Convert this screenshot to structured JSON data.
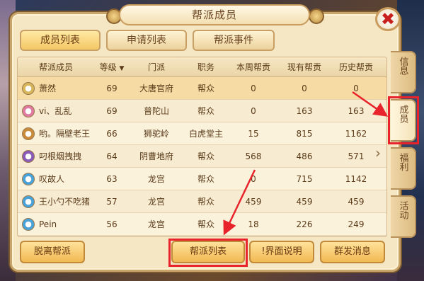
{
  "title": "帮派成员",
  "tabs": [
    {
      "label": "成员列表",
      "active": true
    },
    {
      "label": "申请列表",
      "active": false
    },
    {
      "label": "帮派事件",
      "active": false
    }
  ],
  "columns": [
    "帮派成员",
    "等级",
    "门派",
    "职务",
    "本周帮贡",
    "现有帮贡",
    "历史帮贡"
  ],
  "sort_indicator": "▼",
  "members": [
    {
      "name": "萧然",
      "level": "69",
      "school": "大唐官府",
      "role": "帮众",
      "week": "0",
      "current": "0",
      "history": "0",
      "avatar_color": "#d8b65a"
    },
    {
      "name": "vi、乱乱",
      "level": "69",
      "school": "普陀山",
      "role": "帮众",
      "week": "0",
      "current": "163",
      "history": "163",
      "avatar_color": "#e07aa0"
    },
    {
      "name": "哟。隔壁老王",
      "level": "66",
      "school": "狮驼岭",
      "role": "白虎堂主",
      "week": "15",
      "current": "815",
      "history": "1162",
      "avatar_color": "#c98a3a"
    },
    {
      "name": "叼根烟拽拽",
      "level": "64",
      "school": "阴曹地府",
      "role": "帮众",
      "week": "568",
      "current": "486",
      "history": "571",
      "avatar_color": "#8a5ab8"
    },
    {
      "name": "叹故人",
      "level": "63",
      "school": "龙宫",
      "role": "帮众",
      "week": "0",
      "current": "715",
      "history": "1142",
      "avatar_color": "#4aa3d8"
    },
    {
      "name": "王小勺不吃猪",
      "level": "57",
      "school": "龙宫",
      "role": "帮众",
      "week": "459",
      "current": "459",
      "history": "459",
      "avatar_color": "#4aa3d8"
    },
    {
      "name": "Pein",
      "level": "56",
      "school": "龙宫",
      "role": "帮众",
      "week": "18",
      "current": "226",
      "history": "249",
      "avatar_color": "#4aa3d8"
    }
  ],
  "side_tabs": [
    "信息",
    "成员",
    "福利",
    "活动"
  ],
  "buttons": {
    "leave": "脱离帮派",
    "list": "帮派列表",
    "help": "!界面说明",
    "broadcast": "群发消息"
  },
  "close_symbol": "✖",
  "more_arrow": "›"
}
